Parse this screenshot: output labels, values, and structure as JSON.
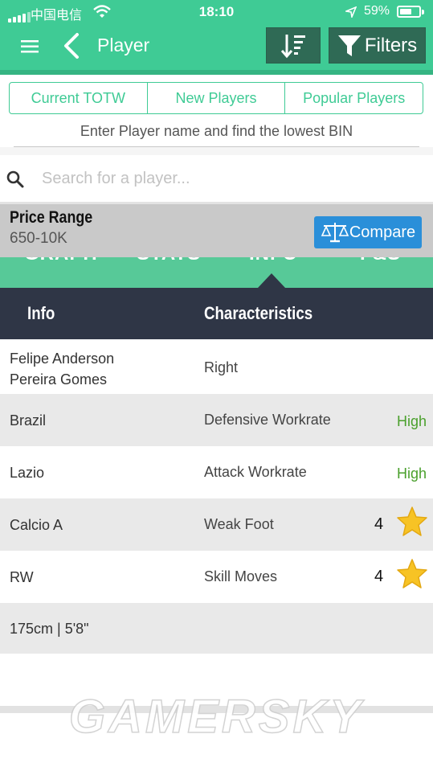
{
  "status_bar": {
    "carrier": "中国电信",
    "time": "18:10",
    "battery": "59%",
    "battery_level": 0.59
  },
  "nav": {
    "title": "Player",
    "filters_label": "Filters",
    "icons": [
      "menu-icon",
      "back-chevron-icon",
      "sort-icon",
      "filter-funnel-icon"
    ]
  },
  "tabs": [
    "Current TOTW",
    "New Players",
    "Popular Players"
  ],
  "hint": "Enter Player name and find the lowest BIN",
  "search": {
    "placeholder": "Search for a player..."
  },
  "price": {
    "title": "Price Range",
    "value": "650-10K",
    "compare_label": "Compare"
  },
  "hidden_tabs": [
    "GRAPH",
    "STATS",
    "INFO",
    "F&S"
  ],
  "table": {
    "col1": "Info",
    "col2": "Characteristics",
    "rows": [
      {
        "info": "Felipe Anderson Pereira Gomes",
        "info_line1": "Felipe Anderson",
        "info_line2": "Pereira Gomes",
        "char": "Right",
        "value": ""
      },
      {
        "info": "Brazil",
        "char": "Defensive Workrate",
        "value": "High"
      },
      {
        "info": "Lazio",
        "char": "Attack Workrate",
        "value": "High"
      },
      {
        "info": "Calcio A",
        "char": "Weak Foot",
        "value": "4",
        "stars": 1
      },
      {
        "info": "RW",
        "char": "Skill Moves",
        "value": "4",
        "stars": 1
      },
      {
        "info": "175cm | 5'8\"",
        "char": "",
        "value": ""
      }
    ]
  },
  "watermark": "GAMERSKY",
  "colors": {
    "brand_green": "#3fcb95",
    "header_dark": "#2f3646",
    "compare_blue": "#2a8fd9",
    "high_green": "#4aa02c",
    "star_yellow": "#f7c325"
  }
}
